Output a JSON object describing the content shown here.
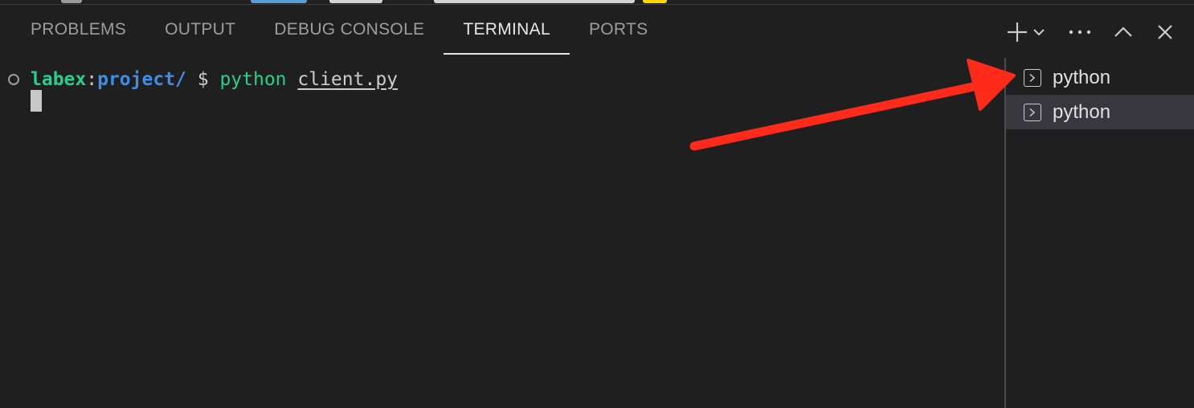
{
  "panel": {
    "tabs": [
      {
        "label": "PROBLEMS",
        "active": false
      },
      {
        "label": "OUTPUT",
        "active": false
      },
      {
        "label": "DEBUG CONSOLE",
        "active": false
      },
      {
        "label": "TERMINAL",
        "active": true
      },
      {
        "label": "PORTS",
        "active": false
      }
    ],
    "actions": [
      "plus-icon",
      "chevron-down-icon",
      "ellipsis-icon",
      "chevron-up-icon",
      "close-icon"
    ]
  },
  "terminal": {
    "user": "labex",
    "colon": ":",
    "path": "project/",
    "dollar": " $ ",
    "command": "python",
    "argument": "client.py"
  },
  "terminal_list": {
    "items": [
      {
        "icon": "terminal-icon",
        "label": "python",
        "selected": false
      },
      {
        "icon": "terminal-icon",
        "label": "python",
        "selected": true
      }
    ]
  },
  "colors": {
    "background": "#1f1f1f",
    "prompt_user": "#23d18b",
    "prompt_path": "#3b8eea",
    "selected_row": "#37373d",
    "annotation_arrow": "#ff2a1a"
  }
}
